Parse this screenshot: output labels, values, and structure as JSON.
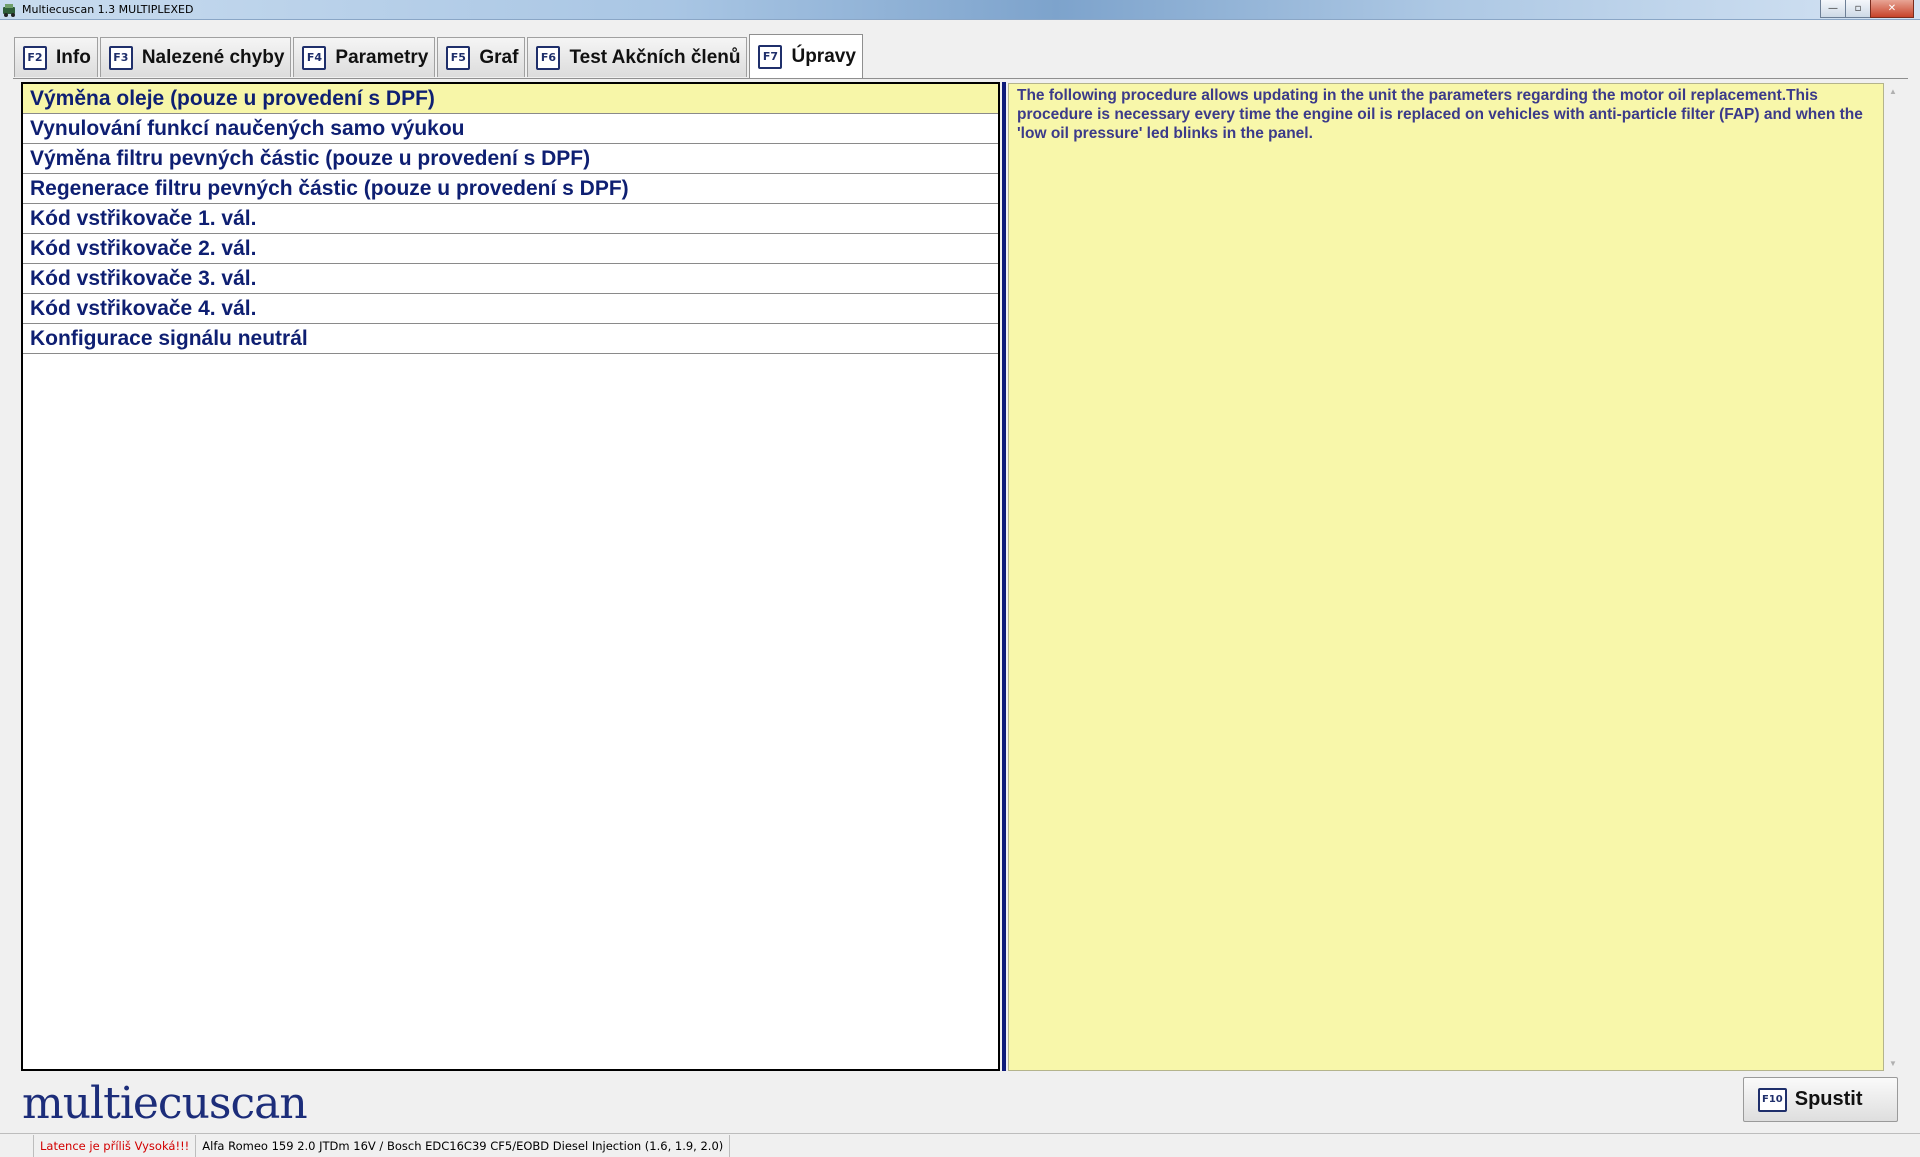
{
  "window": {
    "title": "Multiecuscan 1.3 MULTIPLEXED",
    "buttons": {
      "minimize": "—",
      "maximize": "▫",
      "close": "✕"
    }
  },
  "tabs": [
    {
      "key": "F2",
      "label": "Info"
    },
    {
      "key": "F3",
      "label": "Nalezené chyby"
    },
    {
      "key": "F4",
      "label": "Parametry"
    },
    {
      "key": "F5",
      "label": "Graf"
    },
    {
      "key": "F6",
      "label": "Test Akčních členů"
    },
    {
      "key": "F7",
      "label": "Úpravy",
      "active": true
    }
  ],
  "procedures": [
    {
      "label": "Výměna oleje (pouze u provedení s DPF)",
      "selected": true
    },
    {
      "label": "Vynulování funkcí naučených samo výukou"
    },
    {
      "label": "Výměna filtru pevných částic (pouze u provedení s DPF)"
    },
    {
      "label": "Regenerace filtru pevných částic (pouze u provedení s DPF)"
    },
    {
      "label": "Kód vstřikovače 1. vál."
    },
    {
      "label": "Kód vstřikovače 2. vál."
    },
    {
      "label": "Kód vstřikovače 3. vál."
    },
    {
      "label": "Kód vstřikovače 4. vál."
    },
    {
      "label": "Konfigurace signálu neutrál"
    }
  ],
  "description": "The following procedure allows updating in the unit the parameters regarding the motor oil replacement.This procedure is necessary every time the engine oil is replaced on vehicles with anti-particle filter (FAP) and when the 'low oil pressure' led blinks in the panel.",
  "scroll": {
    "up": "▲",
    "down": "▼"
  },
  "logo_text": "multiecuscan",
  "run_button": {
    "key": "F10",
    "label": "Spustit"
  },
  "status": {
    "latency": "Latence je příliš Vysoká!!!",
    "vehicle": "Alfa Romeo 159 2.0 JTDm 16V / Bosch EDC16C39 CF5/EOBD Diesel Injection (1.6, 1.9, 2.0)"
  },
  "colors": {
    "selected_row": "#f7f6a8",
    "list_text": "#0e1f72",
    "description_bg": "#f8f7aa",
    "description_text": "#3b3a8a",
    "latency_warning": "#d20000"
  }
}
